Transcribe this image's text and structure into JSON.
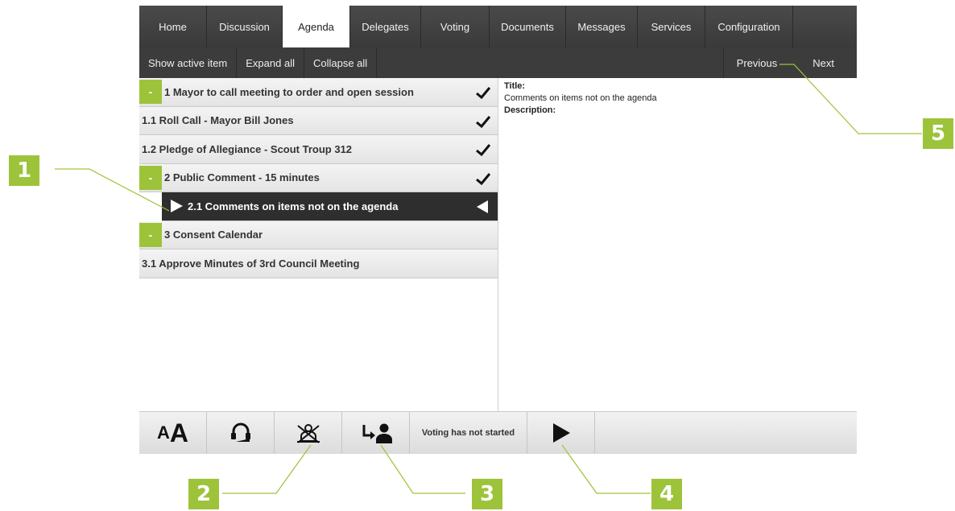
{
  "tabs": [
    {
      "label": "Home",
      "active": false
    },
    {
      "label": "Discussion",
      "active": false
    },
    {
      "label": "Agenda",
      "active": true
    },
    {
      "label": "Delegates",
      "active": false
    },
    {
      "label": "Voting",
      "active": false
    },
    {
      "label": "Documents",
      "active": false
    },
    {
      "label": "Messages",
      "active": false
    },
    {
      "label": "Services",
      "active": false
    },
    {
      "label": "Configuration",
      "active": false
    }
  ],
  "toolbar": {
    "show_active_item": "Show active item",
    "expand_all": "Expand all",
    "collapse_all": "Collapse all",
    "previous": "Previous",
    "next": "Next"
  },
  "agenda": {
    "items": [
      {
        "label": "1 Mayor to call meeting to order and open session",
        "collapsible": true,
        "collapse_symbol": "-",
        "checked": true,
        "selected": false
      },
      {
        "label": "1.1 Roll Call - Mayor Bill Jones",
        "collapsible": false,
        "checked": true,
        "selected": false
      },
      {
        "label": "1.2 Pledge of Allegiance - Scout Troup 312",
        "collapsible": false,
        "checked": true,
        "selected": false
      },
      {
        "label": "2 Public Comment - 15 minutes",
        "collapsible": true,
        "collapse_symbol": "-",
        "checked": true,
        "selected": false
      },
      {
        "label": "2.1 Comments on items not on the agenda",
        "collapsible": false,
        "checked": false,
        "selected": true
      },
      {
        "label": "3 Consent Calendar",
        "collapsible": true,
        "collapse_symbol": "-",
        "checked": false,
        "selected": false
      },
      {
        "label": "3.1 Approve Minutes of 3rd Council Meeting",
        "collapsible": false,
        "checked": false,
        "selected": false
      }
    ]
  },
  "details": {
    "title_label": "Title:",
    "title_value": "Comments on items not on the agenda",
    "description_label": "Description:"
  },
  "bottombar": {
    "font_size_small": "A",
    "font_size_big": "A",
    "icons": [
      "font-size-icon",
      "headset-icon",
      "no-speaker-icon",
      "request-speak-icon",
      "play-icon"
    ],
    "voting_status": "Voting has not started"
  },
  "callouts": [
    "1",
    "2",
    "3",
    "4",
    "5"
  ],
  "colors": {
    "accent": "#9dc33a",
    "tabbar": "#404040",
    "selected_row": "#2e2e2e"
  }
}
